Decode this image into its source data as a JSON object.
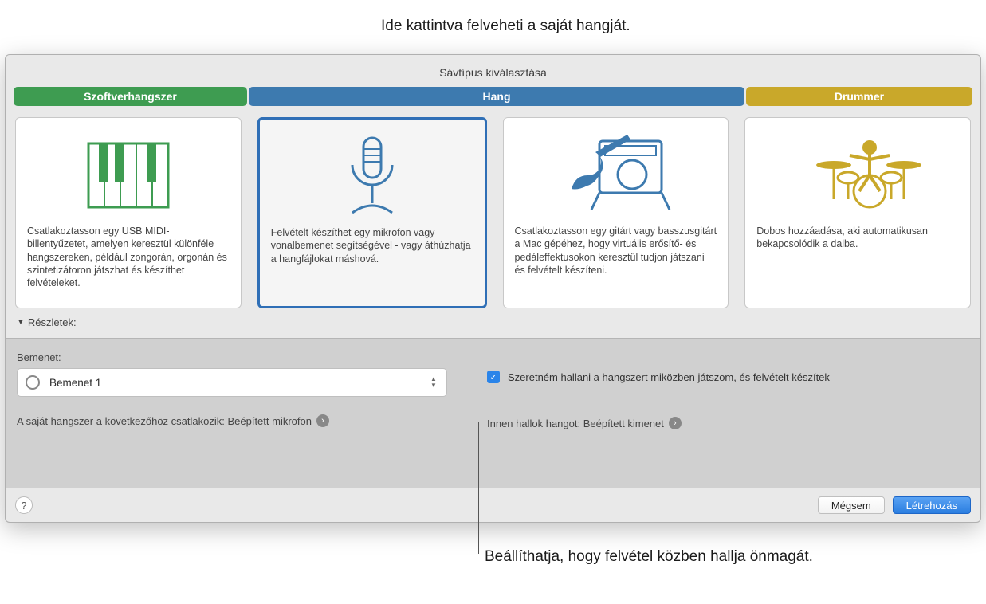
{
  "callout_top": "Ide kattintva felveheti a saját hangját.",
  "callout_bottom": "Beállíthatja, hogy felvétel közben hallja önmagát.",
  "dialog": {
    "title": "Sávtípus kiválasztása",
    "segments": {
      "software": "Szoftverhangszer",
      "audio": "Hang",
      "drummer": "Drummer"
    },
    "cards": {
      "software_desc": "Csatlakoztasson egy USB MIDI-billentyűzetet, amelyen keresztül különféle hangszereken, például zongorán, orgonán és szintetizátoron játszhat és készíthet felvételeket.",
      "mic_desc": "Felvételt készíthet egy mikrofon vagy vonalbemenet segítségével - vagy áthúzhatja a hangfájlokat máshová.",
      "guitar_desc": "Csatlakoztasson egy gitárt vagy basszusgitárt a Mac gépéhez, hogy virtuális erősítő- és pedáleffektusokon keresztül tudjon játszani és felvételt készíteni.",
      "drummer_desc": "Dobos hozzáadása, aki automatikusan bekapcsolódik a dalba."
    },
    "details_label": "Részletek:",
    "input_label": "Bemenet:",
    "input_value": "Bemenet 1",
    "connected_text": "A saját hangszer a következőhöz csatlakozik: Beépített mikrofon",
    "monitoring_label": "Szeretném hallani a hangszert miközben játszom, és felvételt készítek",
    "output_text": "Innen hallok hangot: Beépített kimenet",
    "cancel": "Mégsem",
    "create": "Létrehozás"
  }
}
